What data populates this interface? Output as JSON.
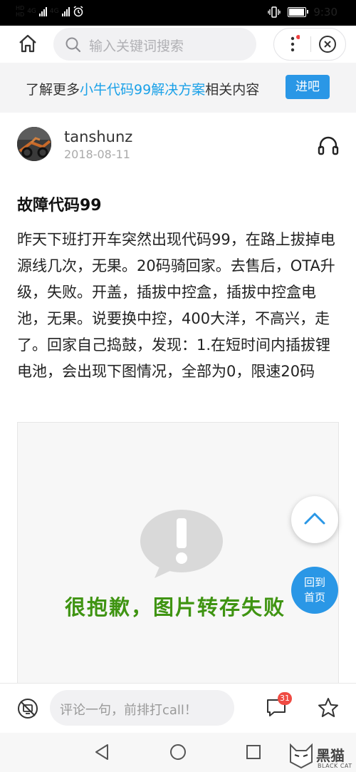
{
  "status_bar": {
    "sim1_label": "HD",
    "sim2_label": "HD",
    "net1": "4G",
    "net2": "4G",
    "time": "9:30",
    "battery_level": 0.85
  },
  "nav": {
    "search_placeholder": "输入关键词搜索",
    "home_icon": "home-icon",
    "search_icon": "search-icon",
    "more_icon": "more-vertical-icon",
    "close_icon": "close-circle-icon"
  },
  "banner": {
    "text_before": "了解更多",
    "highlight": "小牛代码99解决方案",
    "text_after": "相关内容",
    "button_label": "进吧"
  },
  "post": {
    "author": "tanshunz",
    "date": "2018-08-11",
    "title": "故障代码99",
    "body": "昨天下班打开车突然出现代码99，在路上拔掉电源线几次，无果。20码骑回家。去售后，OTA升级，失败。开盖，插拔中控盒，插拔中控盒电池，无果。说要换中控，400大洋，不高兴，走了。回家自己捣鼓，发现：1.在短时间内插拔锂电池，会出现下图情况，全部为0，限速20码",
    "image_error_text": "很抱歉，图片转存失败"
  },
  "floating": {
    "back_home_line1": "回到",
    "back_home_line2": "首页"
  },
  "comment_bar": {
    "placeholder": "评论一句，前排打call！",
    "comment_count": "31"
  },
  "watermark": {
    "text": "黑猫",
    "sub": "BLACK CAT"
  },
  "colors": {
    "accent": "#2a97e6",
    "highlight": "#1aa1e8",
    "error_green": "#3f9412",
    "badge": "#ef4b43"
  }
}
